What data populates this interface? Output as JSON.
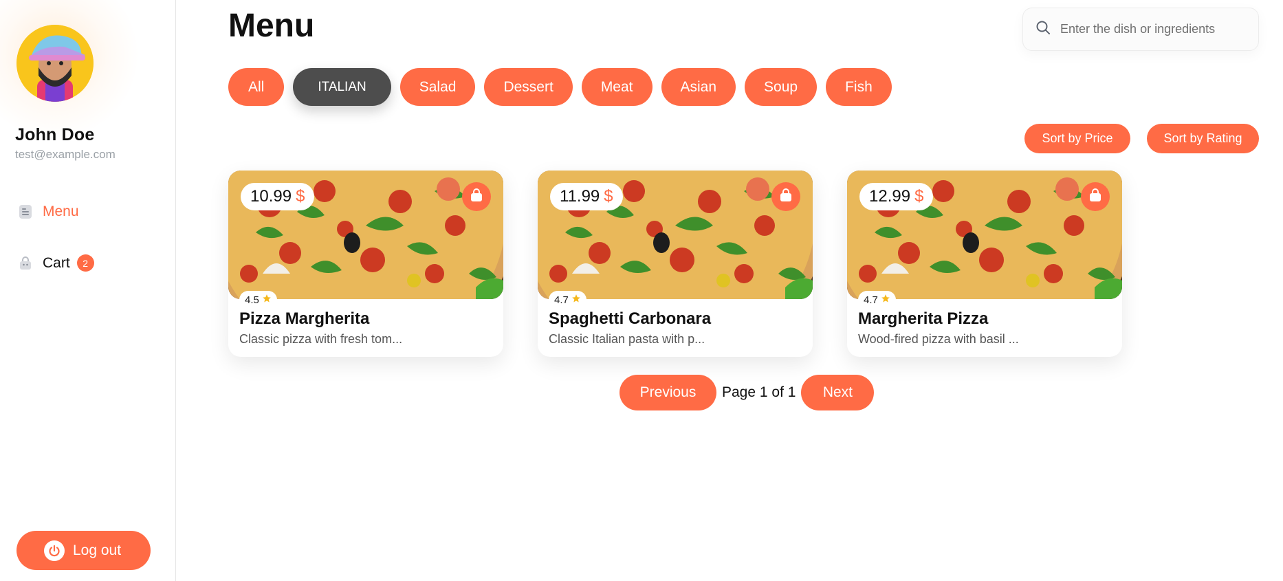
{
  "user": {
    "name": "John Doe",
    "email": "test@example.com"
  },
  "sidebar": {
    "items": [
      {
        "label": "Menu",
        "icon": "menu-doc-icon",
        "active": true
      },
      {
        "label": "Cart",
        "icon": "shopping-bag-icon",
        "badge": "2"
      }
    ],
    "logout_label": "Log out"
  },
  "main": {
    "title": "Menu",
    "search": {
      "placeholder": "Enter the dish or ingredients",
      "value": ""
    },
    "categories": [
      "All",
      "ITALIAN",
      "Salad",
      "Dessert",
      "Meat",
      "Asian",
      "Soup",
      "Fish"
    ],
    "active_category": "ITALIAN",
    "sort": {
      "price_label": "Sort by Price",
      "rating_label": "Sort by Rating"
    },
    "products": [
      {
        "price": "10.99",
        "currency": "$",
        "rating": "4.5",
        "title": "Pizza Margherita",
        "description": "Classic pizza with fresh tom..."
      },
      {
        "price": "11.99",
        "currency": "$",
        "rating": "4.7",
        "title": "Spaghetti Carbonara",
        "description": "Classic Italian pasta with p..."
      },
      {
        "price": "12.99",
        "currency": "$",
        "rating": "4.7",
        "title": "Margherita Pizza",
        "description": "Wood-fired pizza with basil ..."
      }
    ],
    "pagination": {
      "previous_label": "Previous",
      "page_text": "Page 1 of 1",
      "next_label": "Next"
    }
  },
  "colors": {
    "accent": "#ff6b45",
    "active_chip": "#4d4d4d",
    "star": "#f5b81c"
  }
}
